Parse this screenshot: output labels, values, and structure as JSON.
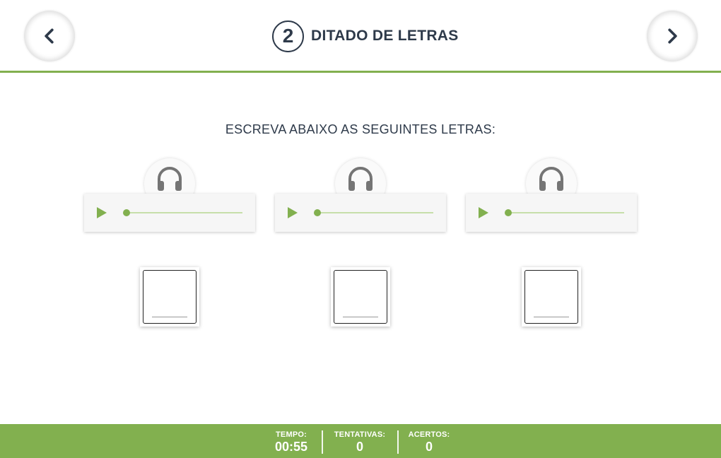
{
  "header": {
    "step_number": "2",
    "title": "DITADO DE LETRAS",
    "prev_icon": "chevron-left-icon",
    "next_icon": "chevron-right-icon"
  },
  "instruction": "ESCREVA ABAIXO AS SEGUINTES LETRAS:",
  "audio_items": [
    {
      "icon": "headphones-icon",
      "play_icon": "play-icon",
      "progress": 0
    },
    {
      "icon": "headphones-icon",
      "play_icon": "play-icon",
      "progress": 0
    },
    {
      "icon": "headphones-icon",
      "play_icon": "play-icon",
      "progress": 0
    }
  ],
  "answers": [
    {
      "value": ""
    },
    {
      "value": ""
    },
    {
      "value": ""
    }
  ],
  "footer": {
    "time_label": "TEMPO:",
    "time_value": "00:55",
    "attempts_label": "TENTATIVAS:",
    "attempts_value": "0",
    "hits_label": "ACERTOS:",
    "hits_value": "0"
  },
  "colors": {
    "accent": "#82b04f",
    "text": "#2e3a4a",
    "track": "#c6dfaa"
  }
}
